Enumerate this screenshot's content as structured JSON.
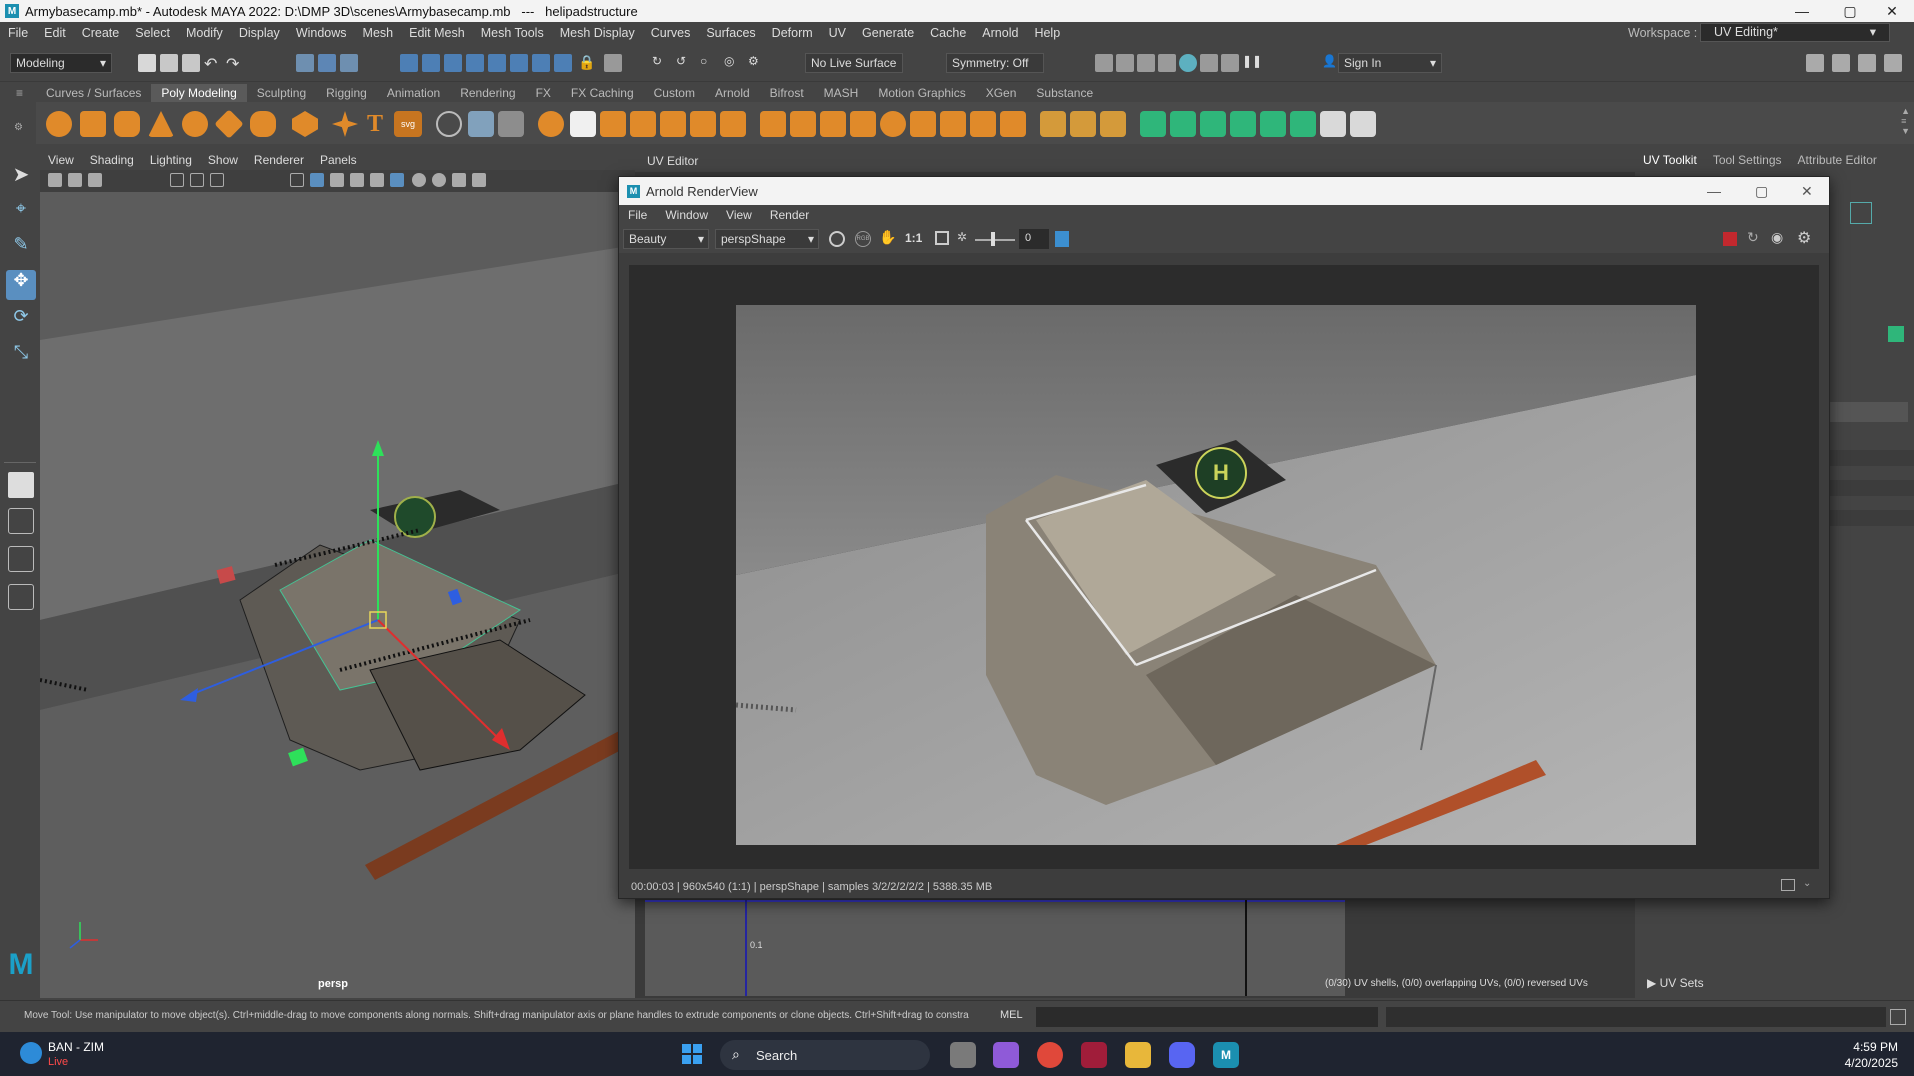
{
  "window": {
    "title": "Armybasecamp.mb* - Autodesk MAYA 2022: D:\\DMP 3D\\scenes\\Armybasecamp.mb   ---   helipadstructure",
    "minimize": "—",
    "maximize": "▢",
    "close": "✕"
  },
  "menubar": [
    "File",
    "Edit",
    "Create",
    "Select",
    "Modify",
    "Display",
    "Windows",
    "Mesh",
    "Edit Mesh",
    "Mesh Tools",
    "Mesh Display",
    "Curves",
    "Surfaces",
    "Deform",
    "UV",
    "Generate",
    "Cache",
    "Arnold",
    "Help"
  ],
  "workspace": {
    "label": "Workspace :",
    "value": "UV Editing*"
  },
  "statusline": {
    "mode": "Modeling",
    "live_surface": "No Live Surface",
    "symmetry": "Symmetry: Off",
    "sign_in": "Sign In"
  },
  "shelf_tabs": [
    "Curves / Surfaces",
    "Poly Modeling",
    "Sculpting",
    "Rigging",
    "Animation",
    "Rendering",
    "FX",
    "FX Caching",
    "Custom",
    "Arnold",
    "Bifrost",
    "MASH",
    "Motion Graphics",
    "XGen",
    "Substance"
  ],
  "shelf_active": "Poly Modeling",
  "viewport": {
    "menus": [
      "View",
      "Shading",
      "Lighting",
      "Show",
      "Renderer",
      "Panels"
    ],
    "camera_label": "persp"
  },
  "uv_editor": {
    "title": "UV Editor",
    "status": "(0/30) UV shells, (0/0) overlapping UVs, (0/0) reversed UVs",
    "tick_label": "0.1"
  },
  "right_tabs": [
    "UV Toolkit",
    "Tool Settings",
    "Attribute Editor"
  ],
  "uv_sets_label": "UV Sets",
  "renderview": {
    "title": "Arnold RenderView",
    "menus": [
      "File",
      "Window",
      "View",
      "Render"
    ],
    "aov": "Beauty",
    "camera": "perspShape",
    "ratio": "1:1",
    "exposure": "0",
    "status": "00:00:03 | 960x540 (1:1) | perspShape  | samples 3/2/2/2/2/2 | 5388.35 MB"
  },
  "helpline": "Move Tool: Use manipulator to move object(s). Ctrl+middle-drag to move components along normals. Shift+drag manipulator axis or plane handles to extrude components or clone objects. Ctrl+Shift+drag to constra",
  "cmd_lang": "MEL",
  "taskbar": {
    "weather_title": "BAN - ZIM",
    "weather_sub": "Live",
    "search": "Search",
    "time": "4:59 PM",
    "date": "4/20/2025"
  }
}
